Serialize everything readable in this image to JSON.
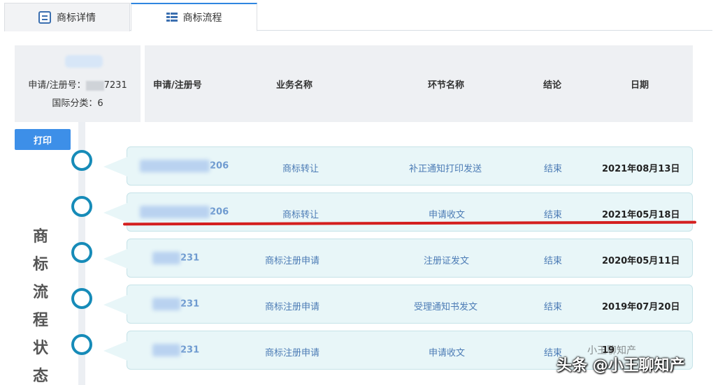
{
  "tabs": [
    {
      "label": "商标详情"
    },
    {
      "label": "商标流程"
    }
  ],
  "info": {
    "reg_label": "申请/注册号：",
    "reg_tail": "7231",
    "class_label": "国际分类：6"
  },
  "table": {
    "headers": [
      "申请/注册号",
      "业务名称",
      "环节名称",
      "结论",
      "日期"
    ],
    "rows": [
      {
        "reg": "206",
        "business": "商标转让",
        "step": "补正通知打印发送",
        "result": "结束",
        "date": "2021年08月13日"
      },
      {
        "reg": "206",
        "business": "商标转让",
        "step": "申请收文",
        "result": "结束",
        "date": "2021年05月18日"
      },
      {
        "reg": "231",
        "business": "商标注册申请",
        "step": "注册证发文",
        "result": "结束",
        "date": "2020年05月11日"
      },
      {
        "reg": "231",
        "business": "商标注册申请",
        "step": "受理通知书发文",
        "result": "结束",
        "date": "2019年07月20日"
      },
      {
        "reg": "231",
        "business": "商标注册申请",
        "step": "申请收文",
        "result": "结束",
        "date": "19"
      }
    ]
  },
  "print_label": "打印",
  "vertical_title": [
    "商",
    "标",
    "流",
    "程",
    "状",
    "态"
  ],
  "watermark": {
    "main": "头条 @小王聊知产",
    "back": "小王聊知产"
  },
  "colors": {
    "accent": "#3d8fe8",
    "timeline": "#168bb8",
    "row_bg": "#e8f6f8",
    "highlight_line": "#d41f1f"
  }
}
